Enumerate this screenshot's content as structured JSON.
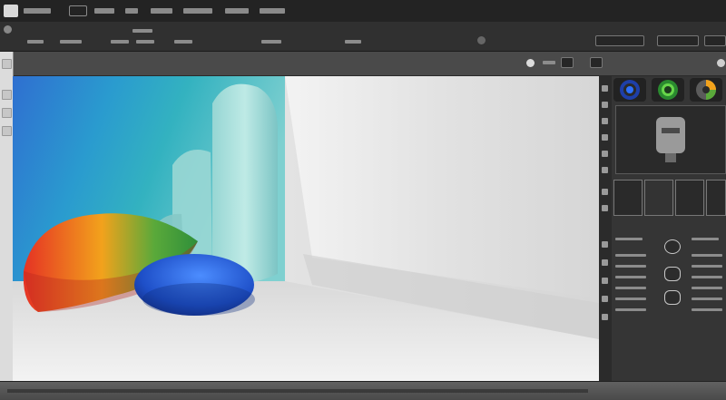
{
  "colors": {
    "chrome_dark": "#232323",
    "panel": "#353535",
    "canvas_bg": "#e9e9e9",
    "shape_blue": "#1e4fc8",
    "shape_orange": "#f2a21c",
    "shape_teal": "#8fd2d2"
  },
  "icons": {
    "app": "app-logo-icon",
    "settings": "gear-icon",
    "sync": "refresh-icon",
    "color_primary": "color-swatch-icon",
    "color_secondary": "color-swatch-icon",
    "color_tertiary": "color-swatch-icon",
    "toggle": "toggle-icon",
    "preview": "preview-image-icon"
  },
  "panels": {
    "preview_caption": "",
    "properties_caption": ""
  }
}
